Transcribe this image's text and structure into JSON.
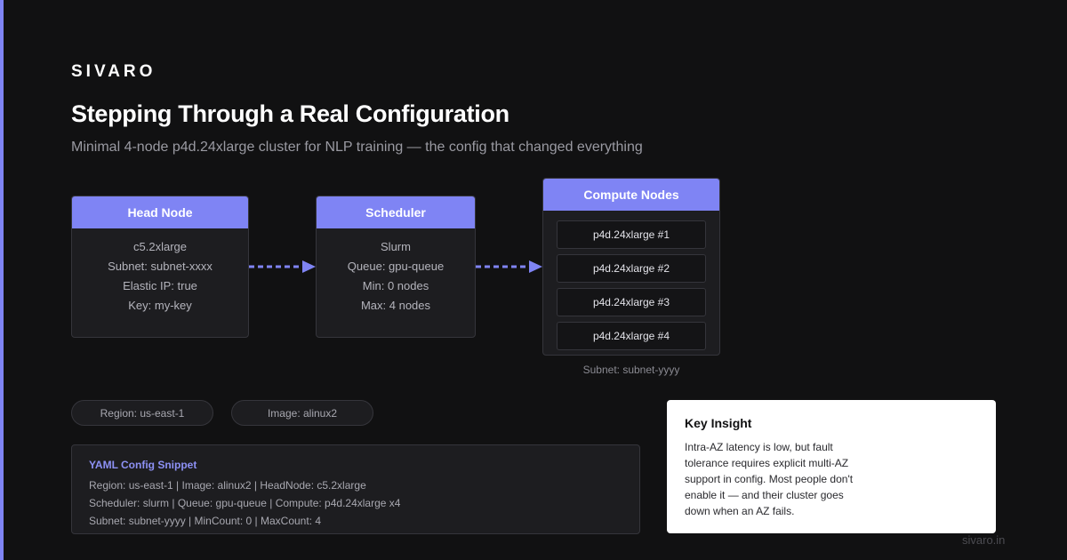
{
  "brand": "SIVARO",
  "title": "Stepping Through a Real Configuration",
  "subtitle": "Minimal 4-node p4d.24xlarge cluster for NLP training — the config that changed everything",
  "colors": {
    "accent": "#7f84f4",
    "background": "#111112",
    "card": "#1d1d20"
  },
  "head_node": {
    "header": "Head Node",
    "lines": [
      "c5.2xlarge",
      "Subnet: subnet-xxxx",
      "Elastic IP: true",
      "Key: my-key"
    ]
  },
  "scheduler": {
    "header": "Scheduler",
    "lines": [
      "Slurm",
      "Queue: gpu-queue",
      "Min: 0 nodes",
      "Max: 4 nodes"
    ]
  },
  "compute_nodes": {
    "header": "Compute Nodes",
    "items": [
      "p4d.24xlarge #1",
      "p4d.24xlarge #2",
      "p4d.24xlarge #3",
      "p4d.24xlarge #4"
    ],
    "subnet": "Subnet: subnet-yyyy"
  },
  "pills": {
    "region": "Region: us-east-1",
    "image": "Image: alinux2"
  },
  "yaml": {
    "title": "YAML Config Snippet",
    "lines": [
      "Region: us-east-1 | Image: alinux2 | HeadNode: c5.2xlarge",
      "Scheduler: slurm | Queue: gpu-queue | Compute: p4d.24xlarge x4",
      "Subnet: subnet-yyyy | MinCount: 0 | MaxCount: 4"
    ]
  },
  "insight": {
    "title": "Key Insight",
    "text": "Intra-AZ latency is low, but fault tolerance requires explicit multi-AZ support in config. Most people don't enable it — and their cluster goes down when an AZ fails."
  },
  "footer": "sivaro.in"
}
